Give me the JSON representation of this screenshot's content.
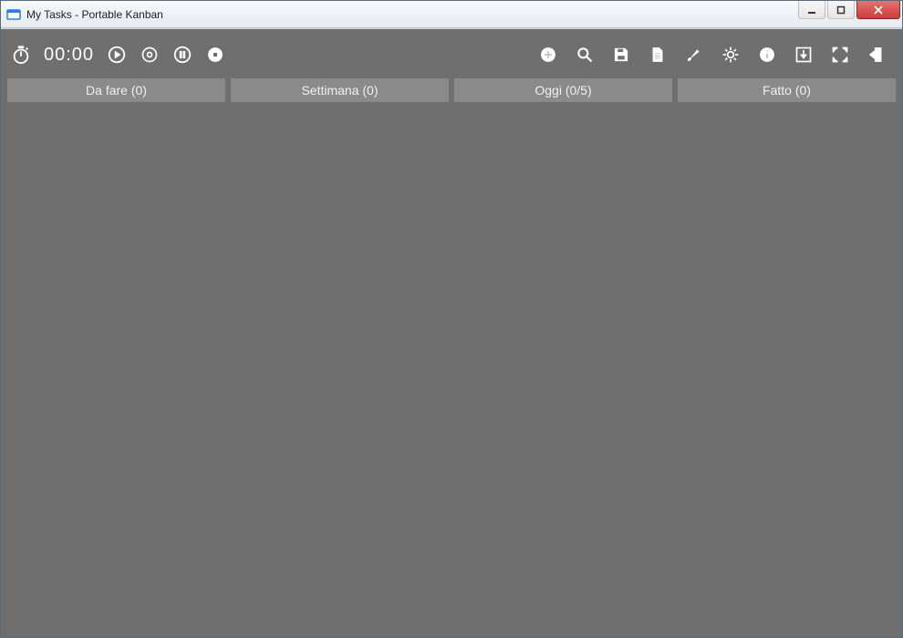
{
  "window": {
    "title": "My Tasks - Portable Kanban"
  },
  "timer": {
    "value": "00:00"
  },
  "columns": [
    {
      "label": "Da fare (0)"
    },
    {
      "label": "Settimana (0)"
    },
    {
      "label": "Oggi (0/5)"
    },
    {
      "label": "Fatto (0)"
    }
  ]
}
